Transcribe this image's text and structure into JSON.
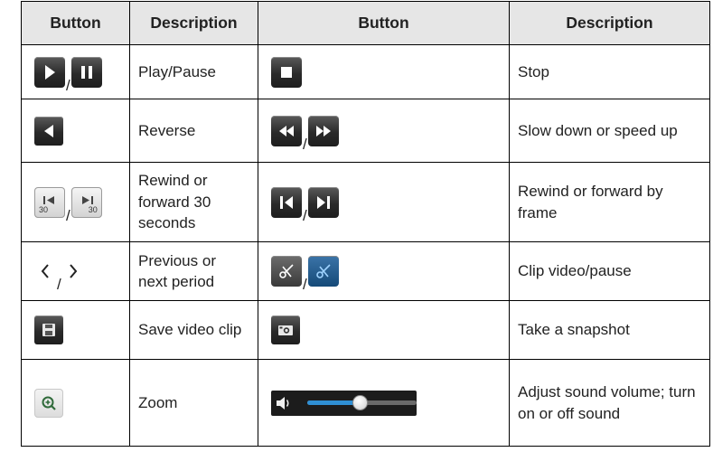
{
  "header": {
    "col1": "Button",
    "col2": "Description",
    "col3": "Button",
    "col4": "Description"
  },
  "rows": [
    {
      "left_icons": [
        "play-icon",
        "pause-icon"
      ],
      "left_desc": "Play/Pause",
      "right_icons": [
        "stop-icon"
      ],
      "right_desc": "Stop"
    },
    {
      "left_icons": [
        "reverse-icon"
      ],
      "left_desc": "Reverse",
      "right_icons": [
        "slow-down-icon",
        "speed-up-icon"
      ],
      "right_desc": "Slow down or speed up"
    },
    {
      "left_icons": [
        "rewind-30-seconds-icon",
        "forward-30-seconds-icon"
      ],
      "left_desc": "Rewind or forward 30 seconds",
      "right_icons": [
        "rewind-frame-icon",
        "forward-frame-icon"
      ],
      "right_desc": "Rewind or forward by frame"
    },
    {
      "left_icons": [
        "previous-period-icon",
        "next-period-icon"
      ],
      "left_desc": "Previous or next period",
      "right_icons": [
        "clip-video-icon",
        "clip-pause-icon"
      ],
      "right_desc": "Clip video/pause"
    },
    {
      "left_icons": [
        "save-icon"
      ],
      "left_desc": "Save video clip",
      "right_icons": [
        "camera-icon"
      ],
      "right_desc": "Take a snapshot"
    },
    {
      "left_icons": [
        "zoom-icon"
      ],
      "left_desc": "Zoom",
      "right_icons": [
        "volume-icon",
        "volume-slider"
      ],
      "right_desc": "Adjust sound volume; turn on or off sound"
    }
  ],
  "icon_glyphs": {
    "slash": "/",
    "thirty": "30"
  },
  "volume": {
    "level_percent": 48
  }
}
